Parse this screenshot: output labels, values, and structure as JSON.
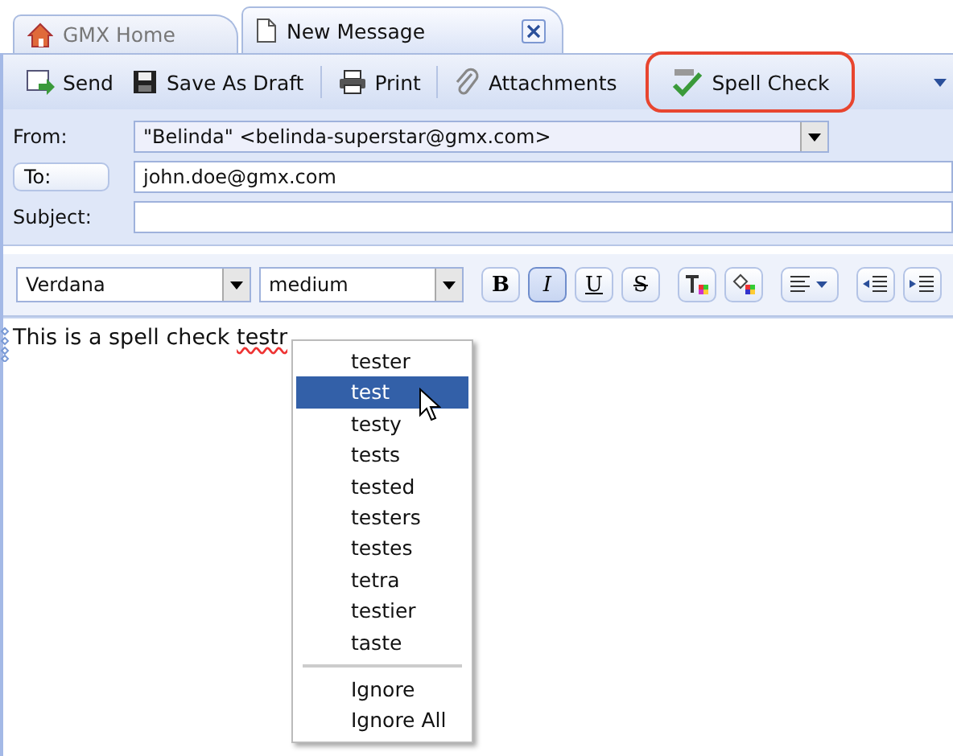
{
  "tabs": [
    {
      "label": "GMX Home",
      "kind": "home",
      "selected": false
    },
    {
      "label": "New Message",
      "kind": "page",
      "selected": true,
      "closable": true
    }
  ],
  "toolbar": [
    {
      "label": "Send",
      "kind": "send"
    },
    {
      "label": "Save As Draft",
      "kind": "disk"
    },
    {
      "label": "Print",
      "kind": "printer"
    },
    {
      "label": "Attachments",
      "kind": "clip"
    },
    {
      "label": "Spell Check",
      "kind": "check",
      "highlighted": true
    }
  ],
  "header": {
    "from_label": "From:",
    "from_value": "\"Belinda\" <belinda-superstar@gmx.com>",
    "to_label": "To:",
    "to_value": "john.doe@gmx.com",
    "subject_label": "Subject:"
  },
  "format": {
    "font": "Verdana",
    "size": "medium",
    "styles": [
      {
        "label": "B",
        "kind": "bold",
        "selected": false
      },
      {
        "label": "I",
        "kind": "italic",
        "selected": true
      },
      {
        "label": "U",
        "kind": "underline",
        "selected": false
      },
      {
        "label": "S",
        "kind": "strike",
        "selected": false
      }
    ]
  },
  "body": {
    "text": "This is a spell check ",
    "misspelled": "testr"
  },
  "suggestions": [
    {
      "label": "tester",
      "selected": false
    },
    {
      "label": "test",
      "selected": true
    },
    {
      "label": "testy",
      "selected": false
    },
    {
      "label": "tests",
      "selected": false
    },
    {
      "label": "tested",
      "selected": false
    },
    {
      "label": "testers",
      "selected": false
    },
    {
      "label": "testes",
      "selected": false
    },
    {
      "label": "tetra",
      "selected": false
    },
    {
      "label": "testier",
      "selected": false
    },
    {
      "label": "taste",
      "selected": false
    }
  ],
  "menu_actions": [
    "Ignore",
    "Ignore All"
  ]
}
